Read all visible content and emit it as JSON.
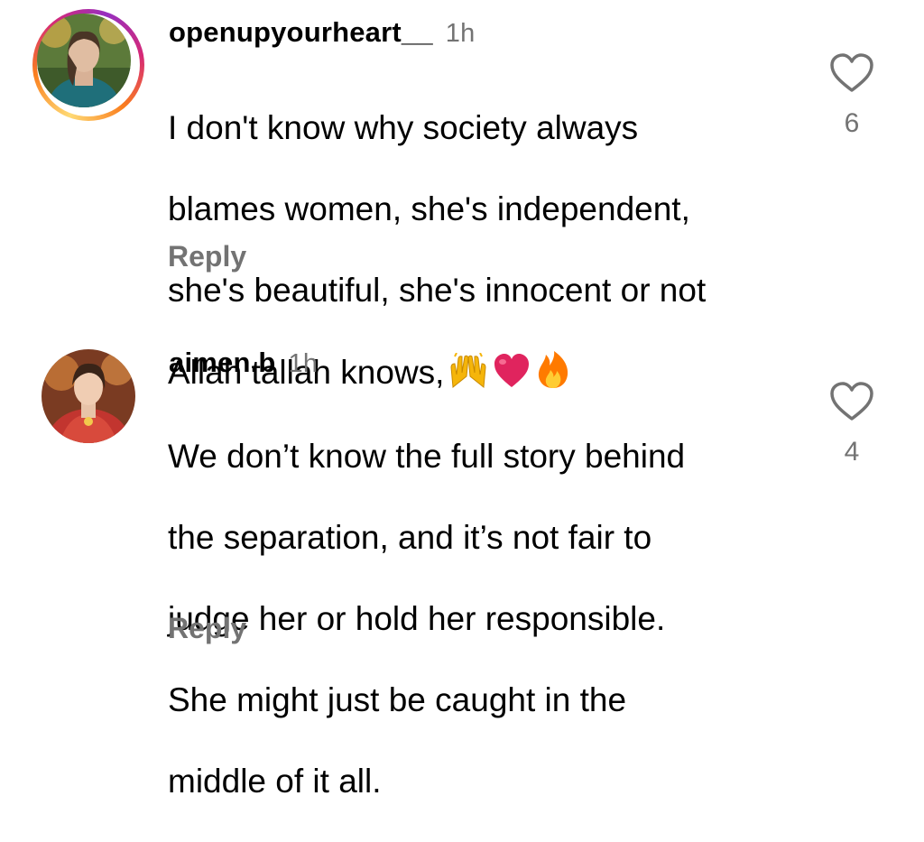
{
  "comments": [
    {
      "username": "openupyourheart__",
      "time": "1h",
      "text_lines": [
        "I don't know why society always",
        "blames women, she's independent,",
        "she's beautiful, she's innocent or not",
        "Allah tallah knows,"
      ],
      "emojis": [
        "raising-hands-icon",
        "red-heart-icon",
        "fire-icon"
      ],
      "likes": "6",
      "reply_label": "Reply",
      "has_story_ring": true
    },
    {
      "username": "aimen.b",
      "time": "1h",
      "text_lines": [
        "We don’t know the full story behind",
        "the separation, and it’s not fair to",
        "judge her or hold her responsible.",
        "She might just be caught in the",
        "middle of it all."
      ],
      "likes": "4",
      "reply_label": "Reply",
      "has_story_ring": false
    }
  ],
  "colors": {
    "text": "#000000",
    "secondary": "#737373",
    "story_ring": [
      "#feda75",
      "#fa7e1e",
      "#d62976",
      "#962fbf"
    ],
    "heart_emoji": "#e0245e",
    "fire_emoji": "#ff7a00",
    "hands_emoji": "#f5b50a"
  }
}
